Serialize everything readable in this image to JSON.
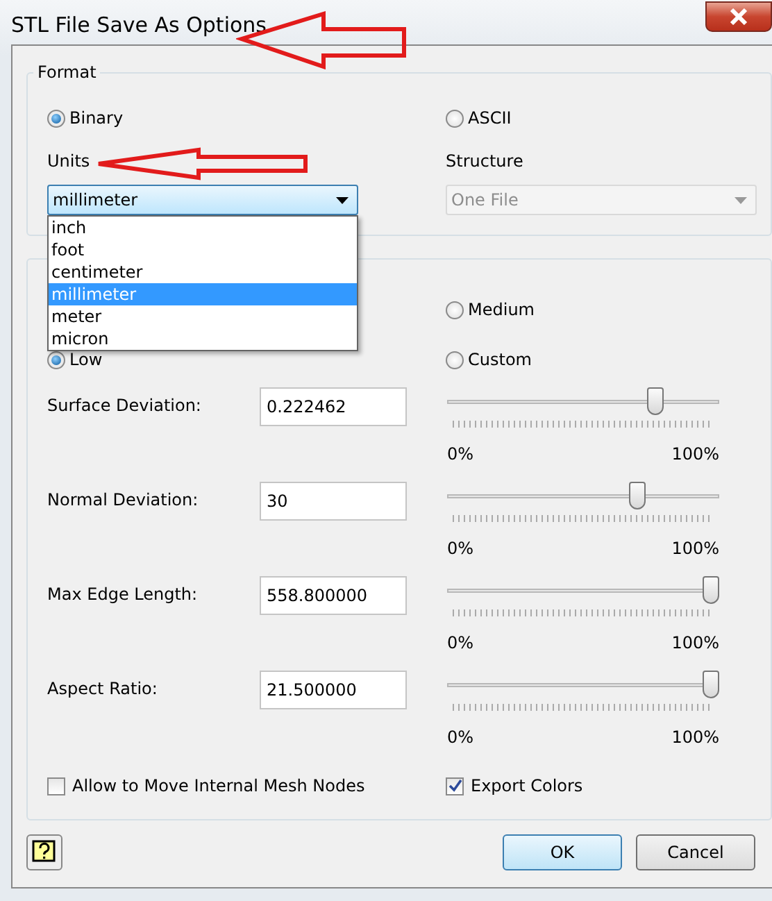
{
  "window": {
    "title": "STL File Save As Options"
  },
  "format": {
    "title": "Format",
    "options": [
      {
        "label": "Binary",
        "selected": true
      },
      {
        "label": "ASCII",
        "selected": false
      }
    ]
  },
  "units": {
    "label": "Units",
    "value": "millimeter",
    "expanded": true,
    "options": [
      {
        "label": "inch",
        "selected": false
      },
      {
        "label": "foot",
        "selected": false
      },
      {
        "label": "centimeter",
        "selected": false
      },
      {
        "label": "millimeter",
        "selected": true
      },
      {
        "label": "meter",
        "selected": false
      },
      {
        "label": "micron",
        "selected": false
      }
    ]
  },
  "structure": {
    "label": "Structure",
    "value": "One File",
    "disabled": true
  },
  "resolution": {
    "options": [
      {
        "label": "Medium",
        "selected": false
      },
      {
        "label": "Low",
        "selected": true
      },
      {
        "label": "Custom",
        "selected": false
      }
    ],
    "rows": [
      {
        "label": "Surface Deviation:",
        "value": "0.222462",
        "level": 0.78,
        "min": "0%",
        "max": "100%"
      },
      {
        "label": "Normal Deviation:",
        "value": "30",
        "level": 0.71,
        "min": "0%",
        "max": "100%"
      },
      {
        "label": "Max Edge Length:",
        "value": "558.800000",
        "level": 1,
        "min": "0%",
        "max": "100%"
      },
      {
        "label": "Aspect Ratio:",
        "value": "21.500000",
        "level": 1,
        "min": "0%",
        "max": "100%"
      }
    ]
  },
  "checkboxes": [
    {
      "label": "Allow to Move Internal Mesh Nodes",
      "checked": false
    },
    {
      "label": "Export Colors",
      "checked": true
    }
  ],
  "buttons": [
    {
      "label": "OK",
      "kind": "default"
    },
    {
      "label": "Cancel",
      "kind": "normal"
    }
  ]
}
